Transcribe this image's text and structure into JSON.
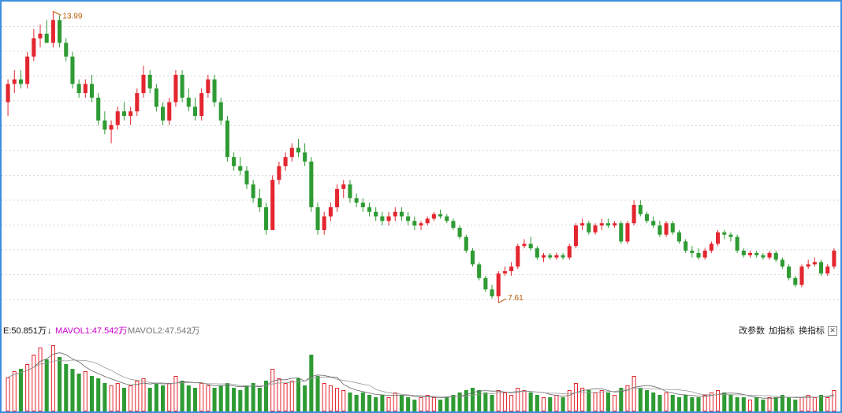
{
  "chart_data": {
    "type": "candlestick",
    "price_ylim": [
      7.3,
      14.1
    ],
    "grid": true,
    "up_color": "#e3262f",
    "down_color": "#2e9b33",
    "annotations": {
      "high_label": "13.99",
      "low_label": "7.61"
    },
    "volume_header": {
      "vol_label": "E:50.851万",
      "vol_arrow": "↓",
      "mavol1_label": "MAVOL1:47.542万",
      "mavol1_arrow": "↓",
      "mavol2_label": "MAVOL2:47.542万",
      "mavol2_arrow": "↓"
    },
    "candles": [
      [
        12.0,
        12.5,
        11.7,
        12.4
      ],
      [
        12.4,
        12.7,
        12.2,
        12.5
      ],
      [
        12.5,
        12.7,
        12.3,
        12.4
      ],
      [
        12.4,
        13.1,
        12.3,
        13.0
      ],
      [
        13.0,
        13.6,
        12.9,
        13.4
      ],
      [
        13.4,
        13.7,
        13.2,
        13.5
      ],
      [
        13.5,
        13.8,
        13.3,
        13.3
      ],
      [
        13.3,
        13.99,
        13.2,
        13.8
      ],
      [
        13.8,
        13.9,
        13.2,
        13.3
      ],
      [
        13.3,
        13.4,
        12.9,
        13.0
      ],
      [
        13.0,
        13.1,
        12.3,
        12.4
      ],
      [
        12.4,
        12.5,
        12.1,
        12.2
      ],
      [
        12.2,
        12.5,
        12.1,
        12.4
      ],
      [
        12.4,
        12.6,
        12.0,
        12.1
      ],
      [
        12.1,
        12.2,
        11.5,
        11.6
      ],
      [
        11.6,
        11.8,
        11.3,
        11.4
      ],
      [
        11.4,
        11.6,
        11.1,
        11.5
      ],
      [
        11.5,
        11.9,
        11.4,
        11.8
      ],
      [
        11.8,
        12.0,
        11.6,
        11.7
      ],
      [
        11.7,
        11.9,
        11.5,
        11.8
      ],
      [
        11.8,
        12.3,
        11.7,
        12.2
      ],
      [
        12.2,
        12.8,
        12.1,
        12.6
      ],
      [
        12.6,
        12.7,
        12.2,
        12.3
      ],
      [
        12.3,
        12.4,
        11.8,
        11.9
      ],
      [
        11.9,
        12.0,
        11.5,
        11.6
      ],
      [
        11.6,
        12.1,
        11.5,
        12.0
      ],
      [
        12.0,
        12.7,
        11.9,
        12.6
      ],
      [
        12.6,
        12.7,
        12.0,
        12.1
      ],
      [
        12.1,
        12.3,
        11.8,
        11.9
      ],
      [
        11.9,
        12.1,
        11.6,
        11.7
      ],
      [
        11.7,
        12.3,
        11.6,
        12.2
      ],
      [
        12.2,
        12.6,
        12.1,
        12.5
      ],
      [
        12.5,
        12.6,
        11.9,
        12.0
      ],
      [
        12.0,
        12.1,
        11.5,
        11.6
      ],
      [
        11.6,
        11.7,
        10.7,
        10.8
      ],
      [
        10.8,
        10.9,
        10.5,
        10.6
      ],
      [
        10.6,
        10.8,
        10.4,
        10.5
      ],
      [
        10.5,
        10.6,
        10.1,
        10.2
      ],
      [
        10.2,
        10.3,
        9.8,
        9.9
      ],
      [
        9.9,
        10.1,
        9.6,
        9.7
      ],
      [
        9.7,
        9.8,
        9.1,
        9.2
      ],
      [
        9.2,
        10.4,
        9.2,
        10.3
      ],
      [
        10.3,
        10.7,
        10.2,
        10.6
      ],
      [
        10.6,
        10.9,
        10.5,
        10.8
      ],
      [
        10.8,
        11.1,
        10.7,
        11.0
      ],
      [
        11.0,
        11.2,
        10.8,
        10.9
      ],
      [
        10.9,
        11.1,
        10.6,
        10.7
      ],
      [
        10.7,
        10.8,
        9.6,
        9.7
      ],
      [
        9.7,
        9.8,
        9.1,
        9.2
      ],
      [
        9.2,
        9.6,
        9.1,
        9.5
      ],
      [
        9.5,
        9.8,
        9.4,
        9.7
      ],
      [
        9.7,
        10.2,
        9.6,
        10.1
      ],
      [
        10.1,
        10.3,
        9.9,
        10.2
      ],
      [
        10.2,
        10.3,
        9.8,
        9.9
      ],
      [
        9.9,
        10.0,
        9.7,
        9.8
      ],
      [
        9.8,
        9.9,
        9.6,
        9.7
      ],
      [
        9.7,
        9.8,
        9.5,
        9.6
      ],
      [
        9.6,
        9.7,
        9.4,
        9.5
      ],
      [
        9.5,
        9.6,
        9.3,
        9.4
      ],
      [
        9.4,
        9.6,
        9.3,
        9.5
      ],
      [
        9.5,
        9.7,
        9.4,
        9.6
      ],
      [
        9.6,
        9.7,
        9.4,
        9.5
      ],
      [
        9.5,
        9.6,
        9.3,
        9.4
      ],
      [
        9.4,
        9.5,
        9.2,
        9.3
      ],
      [
        9.3,
        9.4,
        9.2,
        9.35
      ],
      [
        9.35,
        9.5,
        9.3,
        9.45
      ],
      [
        9.45,
        9.6,
        9.4,
        9.55
      ],
      [
        9.55,
        9.65,
        9.45,
        9.5
      ],
      [
        9.5,
        9.55,
        9.35,
        9.4
      ],
      [
        9.4,
        9.45,
        9.2,
        9.25
      ],
      [
        9.25,
        9.3,
        9.0,
        9.05
      ],
      [
        9.05,
        9.1,
        8.7,
        8.75
      ],
      [
        8.75,
        8.8,
        8.4,
        8.45
      ],
      [
        8.45,
        8.5,
        8.1,
        8.15
      ],
      [
        8.15,
        8.2,
        7.85,
        7.9
      ],
      [
        7.9,
        8.0,
        7.7,
        7.75
      ],
      [
        7.75,
        8.3,
        7.61,
        8.25
      ],
      [
        8.25,
        8.4,
        8.2,
        8.3
      ],
      [
        8.3,
        8.5,
        8.2,
        8.4
      ],
      [
        8.4,
        8.9,
        8.35,
        8.85
      ],
      [
        8.85,
        9.0,
        8.8,
        8.9
      ],
      [
        8.9,
        9.05,
        8.75,
        8.8
      ],
      [
        8.8,
        8.85,
        8.55,
        8.6
      ],
      [
        8.6,
        8.7,
        8.5,
        8.65
      ],
      [
        8.65,
        8.7,
        8.55,
        8.6
      ],
      [
        8.6,
        8.7,
        8.55,
        8.65
      ],
      [
        8.65,
        8.7,
        8.55,
        8.6
      ],
      [
        8.6,
        8.9,
        8.55,
        8.85
      ],
      [
        8.85,
        9.35,
        8.8,
        9.3
      ],
      [
        9.3,
        9.45,
        9.2,
        9.35
      ],
      [
        9.35,
        9.4,
        9.1,
        9.15
      ],
      [
        9.15,
        9.35,
        9.1,
        9.3
      ],
      [
        9.3,
        9.45,
        9.2,
        9.35
      ],
      [
        9.35,
        9.45,
        9.25,
        9.3
      ],
      [
        9.3,
        9.4,
        9.25,
        9.35
      ],
      [
        9.35,
        9.4,
        8.9,
        8.95
      ],
      [
        8.95,
        9.4,
        8.9,
        9.35
      ],
      [
        9.35,
        9.85,
        9.3,
        9.75
      ],
      [
        9.75,
        9.85,
        9.5,
        9.55
      ],
      [
        9.55,
        9.6,
        9.35,
        9.4
      ],
      [
        9.4,
        9.5,
        9.25,
        9.3
      ],
      [
        9.3,
        9.4,
        9.05,
        9.1
      ],
      [
        9.1,
        9.4,
        9.05,
        9.35
      ],
      [
        9.35,
        9.4,
        9.1,
        9.15
      ],
      [
        9.15,
        9.2,
        8.9,
        8.95
      ],
      [
        8.95,
        9.0,
        8.7,
        8.75
      ],
      [
        8.75,
        8.85,
        8.6,
        8.7
      ],
      [
        8.7,
        8.8,
        8.55,
        8.6
      ],
      [
        8.6,
        8.8,
        8.55,
        8.75
      ],
      [
        8.75,
        8.95,
        8.7,
        8.9
      ],
      [
        8.9,
        9.2,
        8.85,
        9.15
      ],
      [
        9.15,
        9.2,
        9.0,
        9.1
      ],
      [
        9.1,
        9.15,
        8.95,
        9.05
      ],
      [
        9.05,
        9.1,
        8.7,
        8.75
      ],
      [
        8.75,
        8.8,
        8.6,
        8.65
      ],
      [
        8.65,
        8.75,
        8.6,
        8.7
      ],
      [
        8.7,
        8.75,
        8.6,
        8.65
      ],
      [
        8.65,
        8.7,
        8.55,
        8.6
      ],
      [
        8.6,
        8.75,
        8.55,
        8.7
      ],
      [
        8.7,
        8.75,
        8.5,
        8.55
      ],
      [
        8.55,
        8.6,
        8.35,
        8.4
      ],
      [
        8.4,
        8.45,
        8.1,
        8.15
      ],
      [
        8.15,
        8.2,
        7.95,
        8.0
      ],
      [
        8.0,
        8.45,
        7.95,
        8.4
      ],
      [
        8.4,
        8.55,
        8.35,
        8.45
      ],
      [
        8.45,
        8.6,
        8.4,
        8.5
      ],
      [
        8.5,
        8.55,
        8.2,
        8.25
      ],
      [
        8.25,
        8.45,
        8.2,
        8.4
      ],
      [
        8.4,
        8.8,
        8.35,
        8.75
      ]
    ],
    "volumes": [
      0.72,
      0.85,
      0.9,
      1.0,
      1.2,
      1.35,
      1.1,
      1.4,
      1.15,
      1.0,
      0.9,
      0.8,
      0.85,
      0.75,
      0.7,
      0.6,
      0.55,
      0.6,
      0.5,
      0.55,
      0.65,
      0.7,
      0.5,
      0.6,
      0.55,
      0.6,
      0.75,
      0.65,
      0.55,
      0.5,
      0.6,
      0.55,
      0.5,
      0.55,
      0.6,
      0.5,
      0.45,
      0.55,
      0.6,
      0.5,
      0.65,
      0.9,
      0.7,
      0.6,
      0.65,
      0.7,
      0.55,
      1.2,
      0.75,
      0.6,
      0.55,
      0.5,
      0.45,
      0.4,
      0.35,
      0.4,
      0.35,
      0.3,
      0.35,
      0.3,
      0.4,
      0.35,
      0.3,
      0.25,
      0.3,
      0.35,
      0.3,
      0.25,
      0.3,
      0.35,
      0.4,
      0.45,
      0.5,
      0.45,
      0.4,
      0.35,
      0.45,
      0.4,
      0.35,
      0.5,
      0.45,
      0.4,
      0.35,
      0.3,
      0.3,
      0.35,
      0.3,
      0.45,
      0.6,
      0.5,
      0.45,
      0.4,
      0.45,
      0.4,
      0.35,
      0.5,
      0.55,
      0.75,
      0.5,
      0.45,
      0.4,
      0.35,
      0.4,
      0.35,
      0.3,
      0.35,
      0.3,
      0.3,
      0.35,
      0.4,
      0.45,
      0.4,
      0.35,
      0.3,
      0.3,
      0.25,
      0.3,
      0.25,
      0.3,
      0.3,
      0.35,
      0.3,
      0.25,
      0.3,
      0.35,
      0.3,
      0.35,
      0.3,
      0.45
    ]
  },
  "toolbar": {
    "params_label": "改参数",
    "add_indicator_label": "加指标",
    "switch_indicator_label": "换指标",
    "close_label": "✕"
  }
}
